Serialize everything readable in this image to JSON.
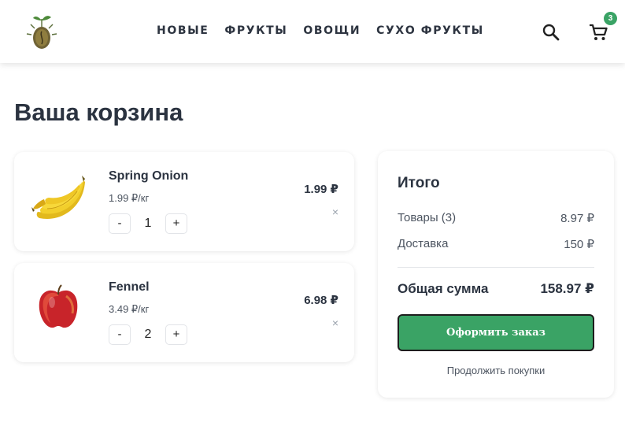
{
  "nav": [
    "НОВЫЕ",
    "ФРУКТЫ",
    "ОВОЩИ",
    "СУХО ФРУКТЫ"
  ],
  "cart": {
    "count": "3"
  },
  "page": {
    "title": "Ваша корзина"
  },
  "items": [
    {
      "name": "Spring Onion",
      "unit_price": "1.99 ₽/кг",
      "qty": "1",
      "total": "1.99 ₽",
      "image": "banana-bunch"
    },
    {
      "name": "Fennel",
      "unit_price": "3.49 ₽/кг",
      "qty": "2",
      "total": "6.98 ₽",
      "image": "red-apple"
    }
  ],
  "qty_controls": {
    "minus": "-",
    "plus": "+"
  },
  "remove_label": "×",
  "summary": {
    "title": "Итого",
    "goods_label": "Товары (3)",
    "goods_value": "8.97 ₽",
    "delivery_label": "Доставка",
    "delivery_value": "150 ₽",
    "total_label": "Общая сумма",
    "total_value": "158.97 ₽",
    "checkout_label": "Оформить заказ",
    "continue_label": "Продолжить покупки"
  },
  "colors": {
    "accent": "#3aa365",
    "text": "#2b3340"
  }
}
